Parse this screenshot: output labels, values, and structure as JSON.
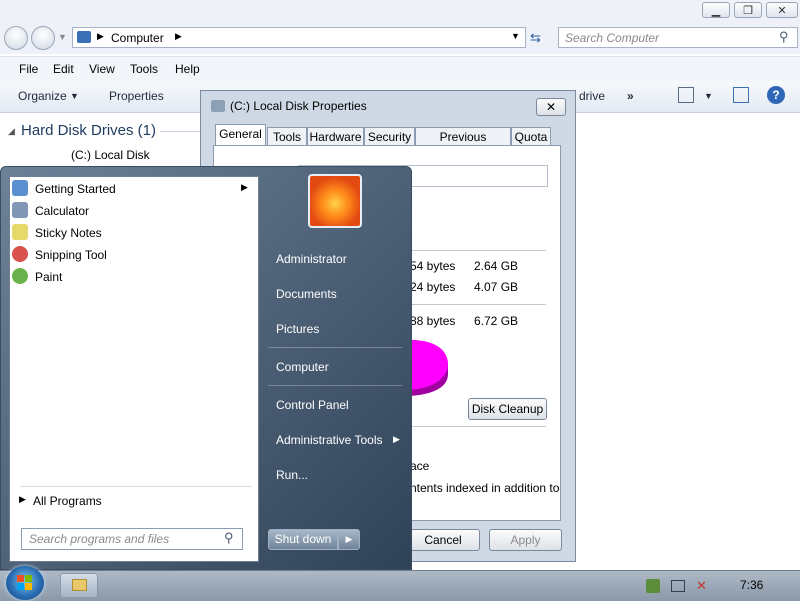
{
  "explorer": {
    "address": "Computer",
    "search_placeholder": "Search Computer",
    "menu": [
      "File",
      "Edit",
      "View",
      "Tools",
      "Help"
    ],
    "toolbar": {
      "organize": "Organize",
      "properties": "Properties",
      "drive": "drive",
      "more": "»"
    },
    "section_title": "Hard Disk Drives (1)",
    "drive_label": "(C:) Local Disk"
  },
  "dialog": {
    "title": "(C:) Local Disk Properties",
    "tabs": [
      "General",
      "Tools",
      "Hardware",
      "Security",
      "Previous Versions",
      "Quota"
    ],
    "used_bytes": "54 bytes",
    "used_gb": "2.64 GB",
    "free_bytes": "24 bytes",
    "free_gb": "4.07 GB",
    "capacity_bytes": "88 bytes",
    "capacity_gb": "6.72 GB",
    "disk_cleanup": "Disk Cleanup",
    "opt1": "ace",
    "opt2": "ntents indexed in addition to",
    "cancel": "Cancel",
    "apply": "Apply",
    "close_glyph": "✕"
  },
  "start_menu": {
    "programs": [
      {
        "label": "Getting Started",
        "icon_color": "#5a8fd0"
      },
      {
        "label": "Calculator",
        "icon_color": "#7f97b5"
      },
      {
        "label": "Sticky Notes",
        "icon_color": "#e6d86a"
      },
      {
        "label": "Snipping Tool",
        "icon_color": "#d9534f"
      },
      {
        "label": "Paint",
        "icon_color": "#6ab04c"
      }
    ],
    "all_programs": "All Programs",
    "search_placeholder": "Search programs and files",
    "right": {
      "administrator": "Administrator",
      "documents": "Documents",
      "pictures": "Pictures",
      "computer": "Computer",
      "control_panel": "Control Panel",
      "admin_tools": "Administrative Tools",
      "run": "Run..."
    },
    "shutdown": "Shut down"
  },
  "taskbar": {
    "time": "7:36"
  },
  "colors": {
    "pie_free": "#ff00ff"
  }
}
